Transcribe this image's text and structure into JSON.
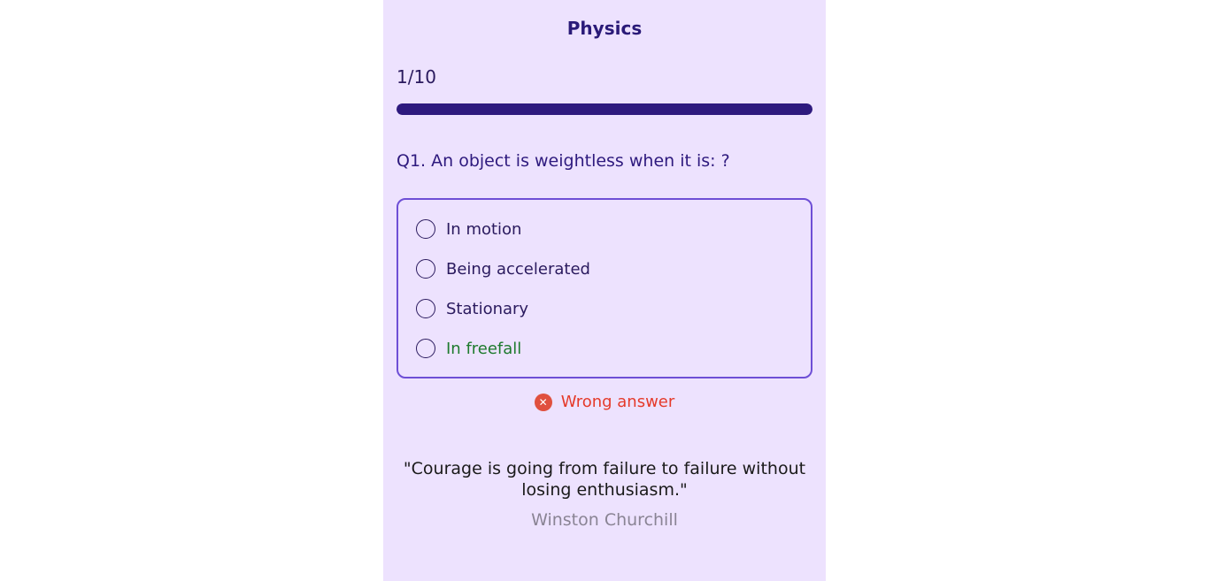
{
  "quiz": {
    "title": "Physics",
    "progress_text": "1/10",
    "progress_fraction": 1.0,
    "question": "Q1. An object is weightless when it is: ?",
    "options": [
      {
        "label": "In motion",
        "correct": false
      },
      {
        "label": "Being accelerated",
        "correct": false
      },
      {
        "label": "Stationary",
        "correct": false
      },
      {
        "label": "In freefall",
        "correct": true
      }
    ],
    "feedback": {
      "icon": "wrong-icon",
      "glyph": "✕",
      "text": "Wrong answer"
    }
  },
  "quote": {
    "text": "\"Courage is going from failure to failure without losing enthusiasm.\"",
    "author": "Winston Churchill"
  },
  "colors": {
    "panel_bg": "#ede2fe",
    "accent": "#2e1a7e",
    "border": "#6e4fd6",
    "correct": "#1e7a2e",
    "wrong": "#e53a2a"
  }
}
